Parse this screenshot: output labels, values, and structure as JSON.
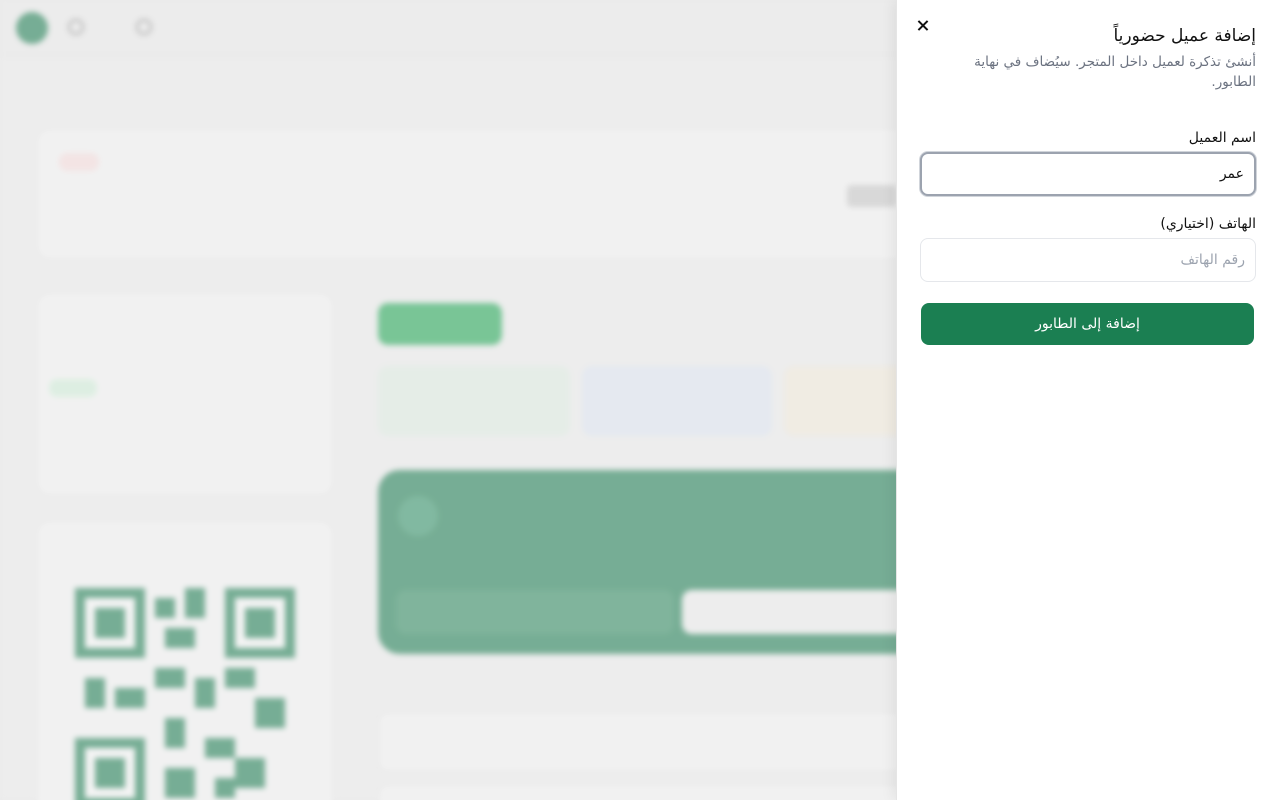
{
  "panel": {
    "title": "إضافة عميل حضورياً",
    "description": "أنشئ تذكرة لعميل داخل المتجر. سيُضاف في نهاية الطابور.",
    "name_label": "اسم العميل",
    "name_value": "عمر",
    "phone_label": "الهاتف (اختياري)",
    "phone_placeholder": "رقم الهاتف",
    "submit_label": "إضافة إلى الطابور"
  },
  "colors": {
    "primary": "#1b7f52",
    "panel_bg": "#ffffff",
    "muted_text": "#6b7280"
  },
  "icons": {
    "close": "close-icon"
  }
}
